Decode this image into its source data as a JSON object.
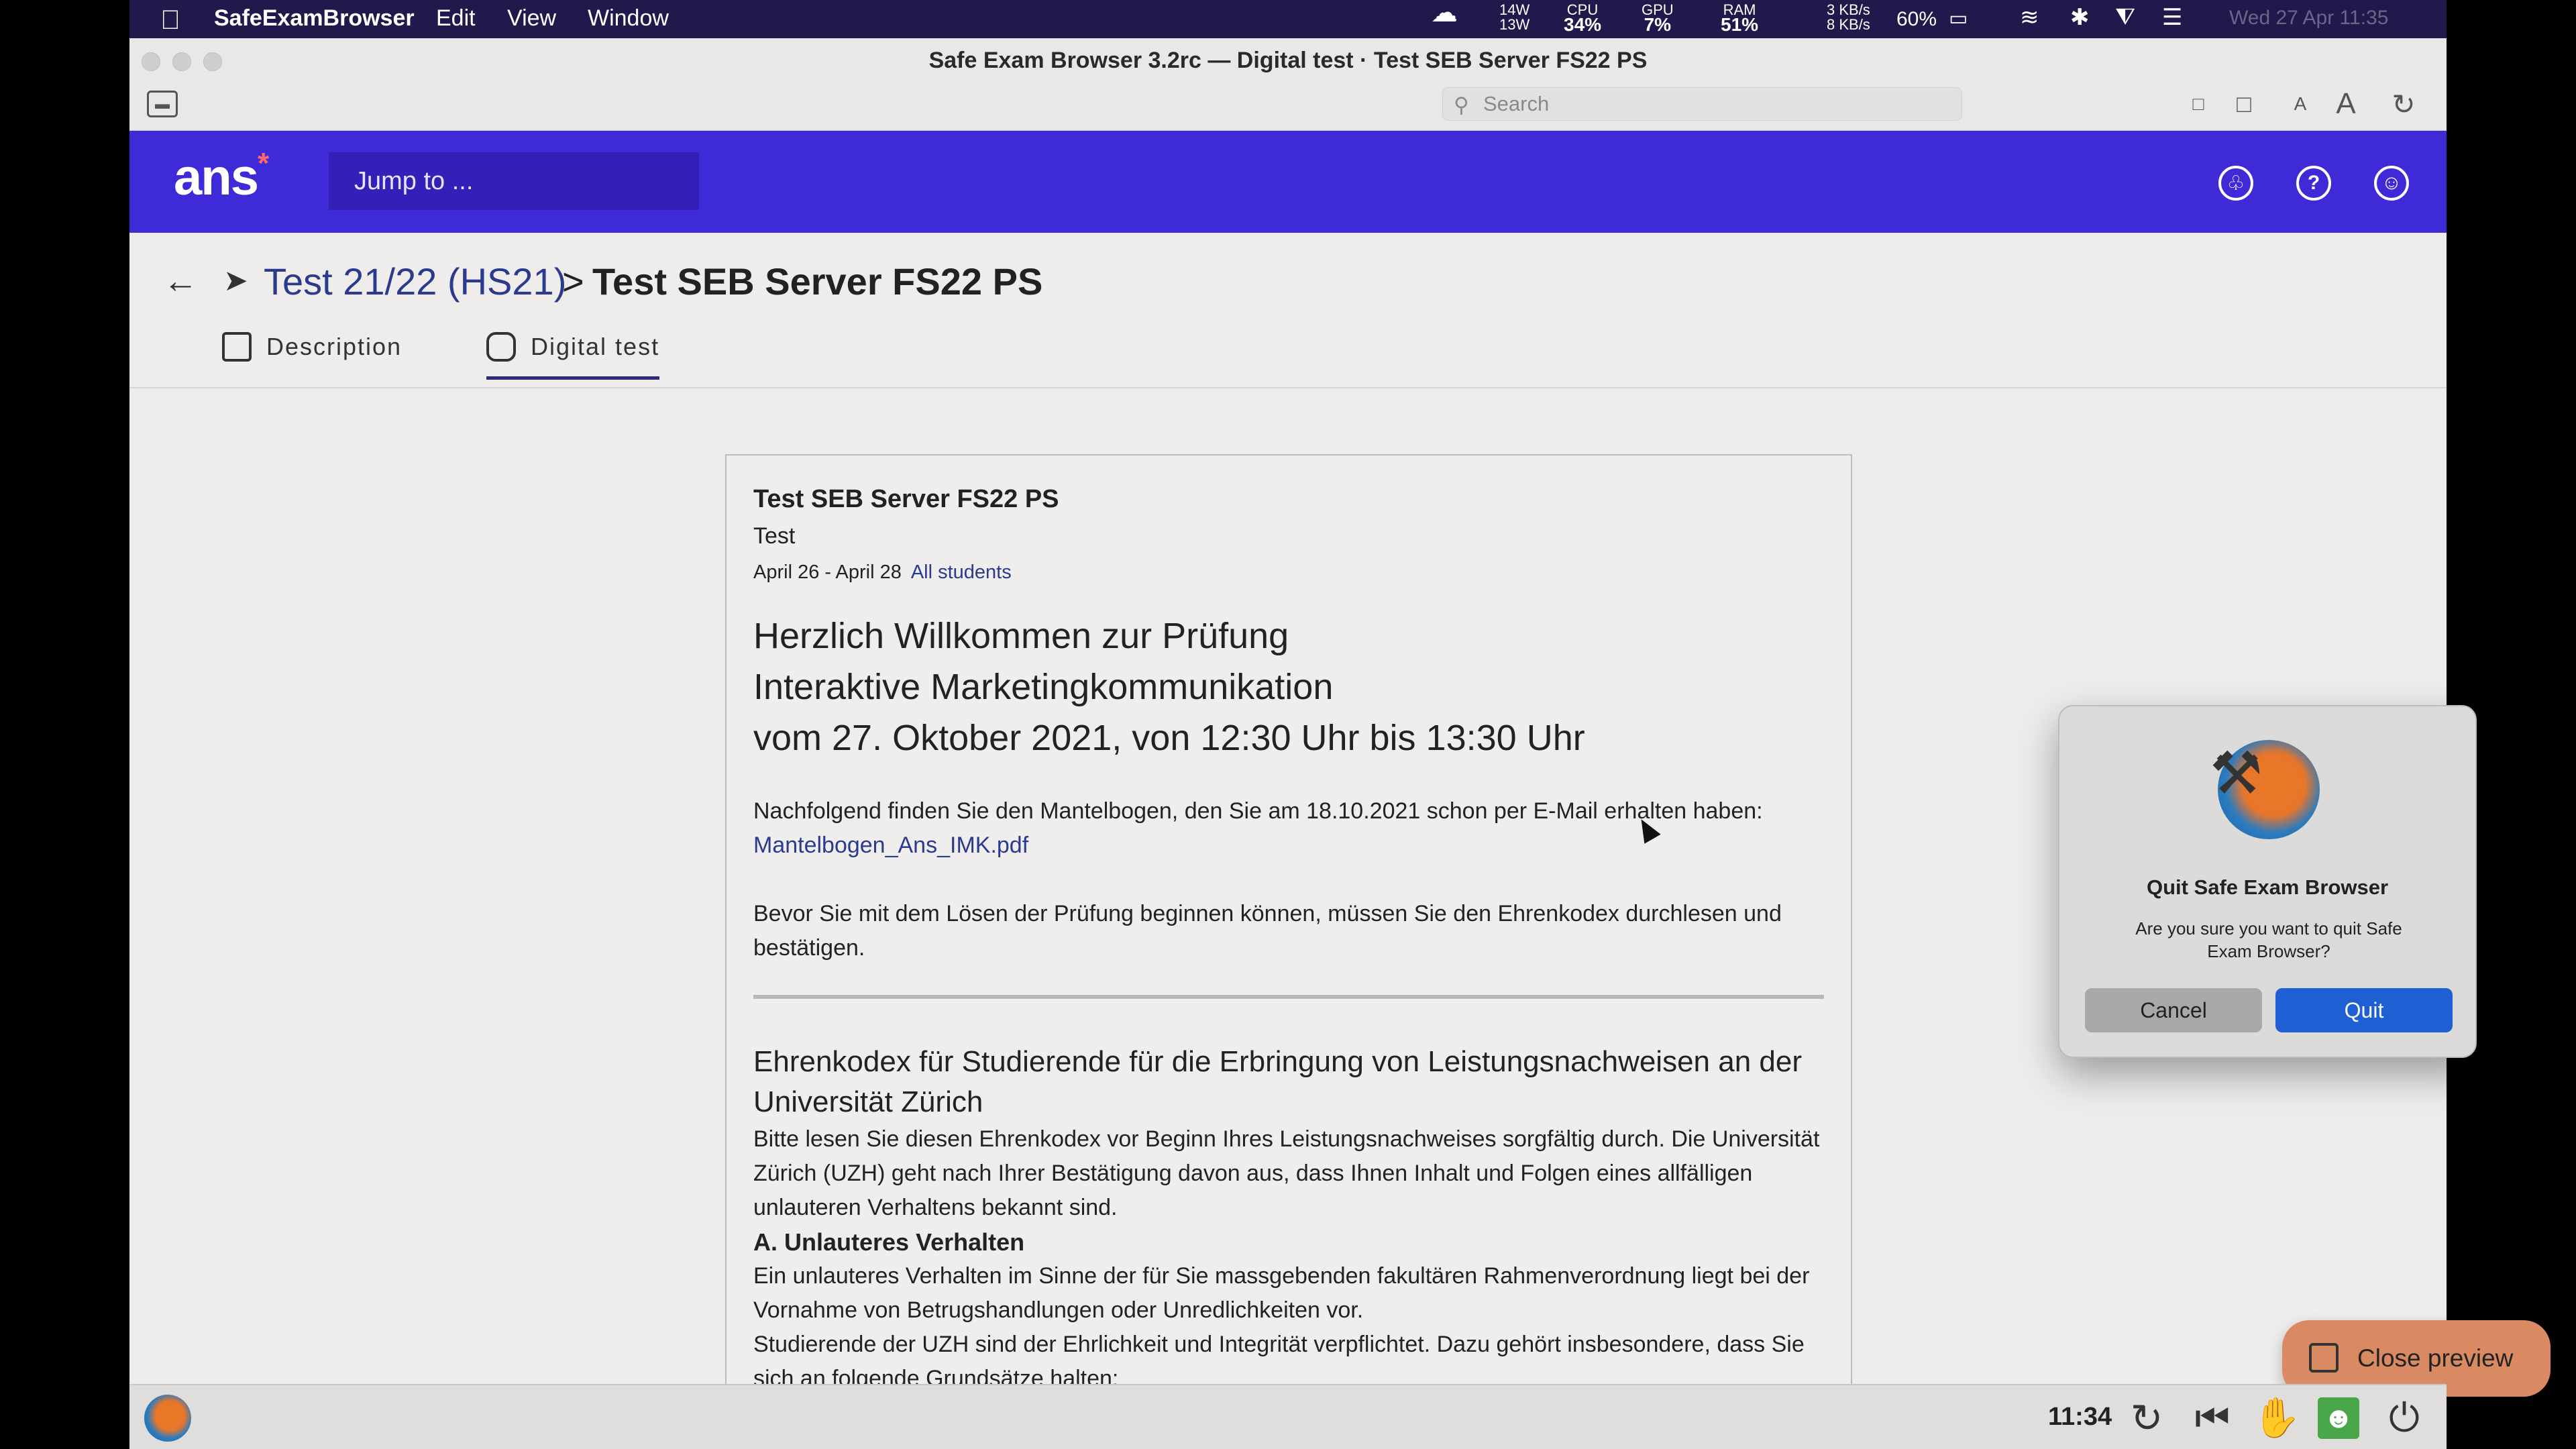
{
  "menubar": {
    "app_name": "SafeExamBrowser",
    "items": [
      "Edit",
      "View",
      "Window"
    ],
    "status": {
      "power": {
        "top": "14W",
        "bottom": "13W"
      },
      "cpu": {
        "label": "CPU",
        "value": "34%"
      },
      "gpu": {
        "label": "GPU",
        "value": "7%"
      },
      "ram": {
        "label": "RAM",
        "value": "51%"
      },
      "net": {
        "top": "3 KB/s",
        "bottom": "8 KB/s"
      },
      "battery": "60%",
      "datetime": "Wed 27 Apr  11:35"
    }
  },
  "window": {
    "title": "Safe Exam Browser 3.2rc  —  Digital test · Test SEB Server FS22 PS",
    "search_placeholder": "Search"
  },
  "appbar": {
    "logo": "ans",
    "logo_mark": "*",
    "jump_placeholder": "Jump to ..."
  },
  "breadcrumb": {
    "parent": "Test 21/22 (HS21)",
    "separator": ">",
    "current": "Test SEB Server FS22 PS"
  },
  "tabs": [
    {
      "label": "Description",
      "active": false
    },
    {
      "label": "Digital test",
      "active": true
    }
  ],
  "card": {
    "title": "Test SEB Server FS22 PS",
    "subtitle": "Test",
    "dates": "April 26 - April 28",
    "audience": "All students",
    "heading_lines": [
      "Herzlich Willkommen zur Prüfung",
      "Interaktive Marketingkommunikation",
      "vom 27. Oktober 2021, von 12:30 Uhr bis 13:30 Uhr"
    ],
    "intro": "Nachfolgend finden Sie den Mantelbogen, den Sie am 18.10.2021 schon per E-Mail erhalten haben:",
    "attachment": "Mantelbogen_Ans_IMK.pdf",
    "before": "Bevor Sie mit dem Lösen der Prüfung beginnen können, müssen Sie den Ehrenkodex durchlesen und bestätigen.",
    "code_heading": "Ehrenkodex für Studierende für die Erbringung von Leistungsnachweisen an der Universität Zürich",
    "code_intro": "Bitte lesen Sie diesen Ehrenkodex vor Beginn Ihres Leistungsnachweises sorgfältig durch. Die Universität Zürich (UZH) geht nach Ihrer Bestätigung davon aus, dass Ihnen Inhalt und Folgen eines allfälligen unlauteren Verhaltens bekannt sind.",
    "section_a": "A. Unlauteres Verhalten",
    "section_a_text": "Ein unlauteres Verhalten im Sinne der für Sie massgebenden fakultären Rahmenverordnung liegt bei der Vornahme von Betrugshandlungen oder Unredlichkeiten vor.",
    "section_a_text2": "Studierende der UZH sind der Ehrlichkeit und Integrität verpflichtet. Dazu gehört insbesondere, dass Sie sich an folgende Grundsätze halten:"
  },
  "dialog": {
    "title": "Quit Safe Exam Browser",
    "message": "Are you sure you want to quit Safe Exam Browser?",
    "cancel": "Cancel",
    "quit": "Quit"
  },
  "close_preview": "Close preview",
  "taskbar": {
    "clock": "11:34"
  }
}
